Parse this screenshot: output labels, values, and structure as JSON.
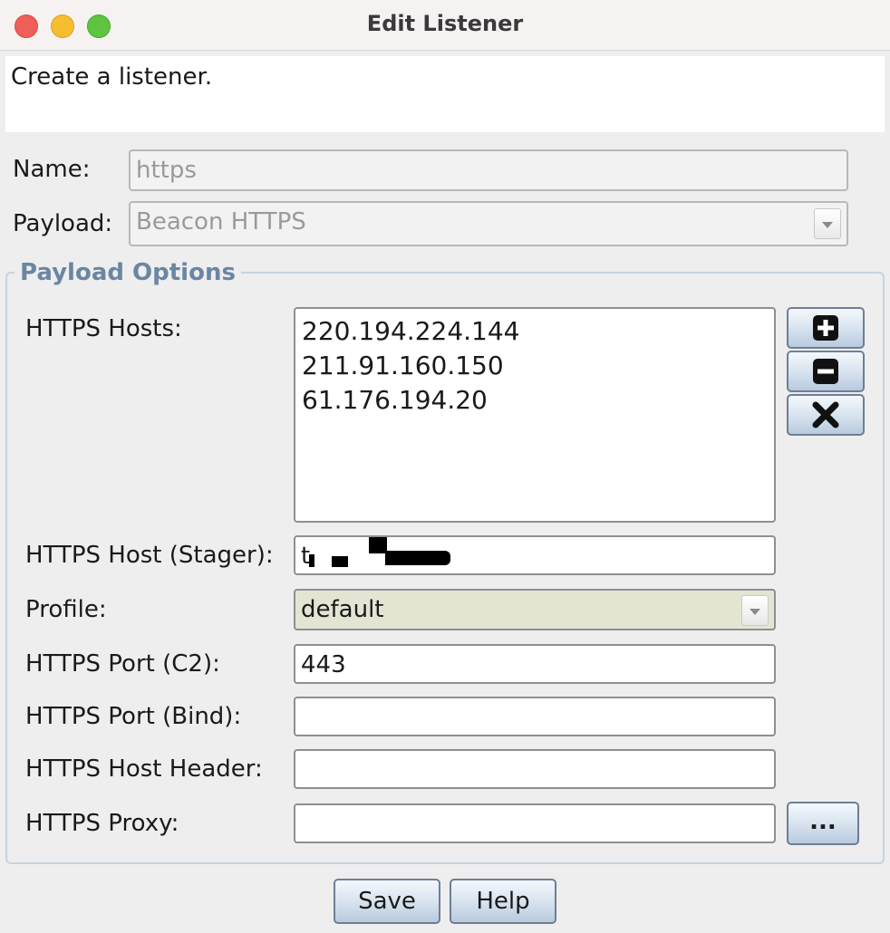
{
  "window": {
    "title": "Edit Listener"
  },
  "description": "Create a listener.",
  "form": {
    "name_label": "Name:",
    "name_value": "https",
    "payload_label": "Payload:",
    "payload_value": "Beacon HTTPS"
  },
  "payload_options": {
    "group_title": "Payload Options",
    "hosts_label": "HTTPS Hosts:",
    "hosts": [
      "220.194.224.144",
      "211.91.160.150",
      "61.176.194.20"
    ],
    "host_buttons": {
      "add_icon": "plus-icon",
      "remove_icon": "minus-icon",
      "clear_icon": "x-icon"
    },
    "stager_label": "HTTPS Host (Stager):",
    "stager_value": "t",
    "profile_label": "Profile:",
    "profile_value": "default",
    "port_c2_label": "HTTPS Port (C2):",
    "port_c2_value": "443",
    "port_bind_label": "HTTPS Port (Bind):",
    "port_bind_value": "",
    "host_header_label": "HTTPS Host Header:",
    "host_header_value": "",
    "proxy_label": "HTTPS Proxy:",
    "proxy_value": "",
    "proxy_button_label": "..."
  },
  "buttons": {
    "save": "Save",
    "help": "Help"
  },
  "colors": {
    "group_title": "#6a86a3",
    "profile_bg": "#e3e5d2",
    "button_gradient_bottom": "#b9cade"
  }
}
